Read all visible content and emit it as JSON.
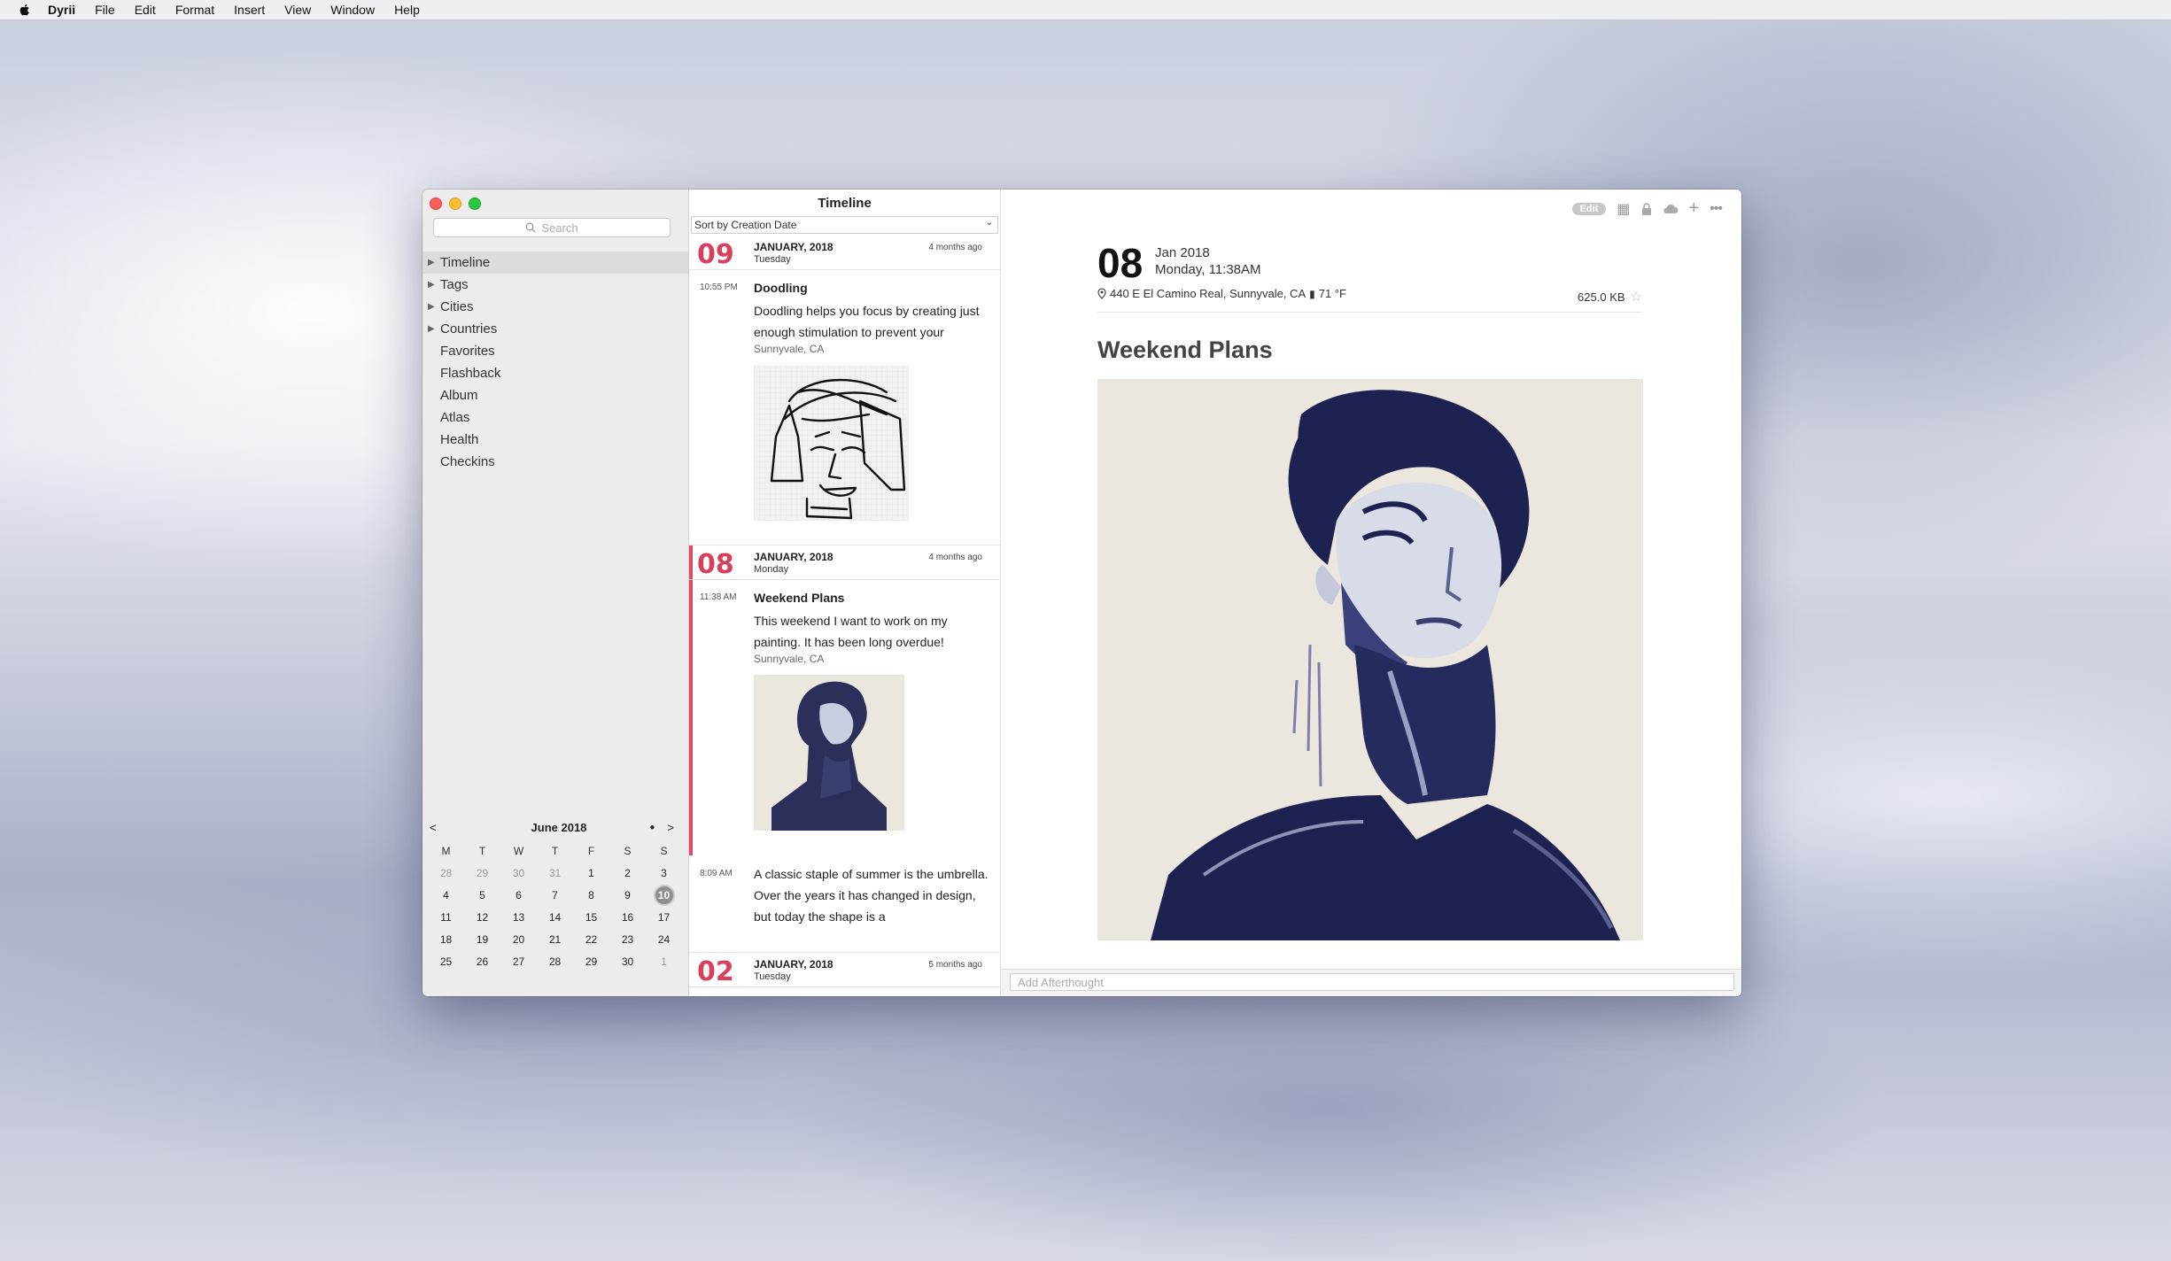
{
  "menubar": {
    "apple_icon": "apple-logo-icon",
    "items": [
      "Dyrii",
      "File",
      "Edit",
      "Format",
      "Insert",
      "View",
      "Window",
      "Help"
    ]
  },
  "sidebar": {
    "search_placeholder": "Search",
    "nav": [
      {
        "label": "Timeline",
        "expandable": true,
        "selected": true
      },
      {
        "label": "Tags",
        "expandable": true
      },
      {
        "label": "Cities",
        "expandable": true
      },
      {
        "label": "Countries",
        "expandable": true
      },
      {
        "label": "Favorites"
      },
      {
        "label": "Flashback"
      },
      {
        "label": "Album"
      },
      {
        "label": "Atlas"
      },
      {
        "label": "Health"
      },
      {
        "label": "Checkins"
      }
    ],
    "calendar": {
      "prev": "<",
      "next": ">",
      "dot": "●",
      "month": "June 2018",
      "weekdays": [
        "M",
        "T",
        "W",
        "T",
        "F",
        "S",
        "S"
      ],
      "weeks": [
        [
          "28",
          "29",
          "30",
          "31",
          "1",
          "2",
          "3"
        ],
        [
          "4",
          "5",
          "6",
          "7",
          "8",
          "9",
          "10"
        ],
        [
          "11",
          "12",
          "13",
          "14",
          "15",
          "16",
          "17"
        ],
        [
          "18",
          "19",
          "20",
          "21",
          "22",
          "23",
          "24"
        ],
        [
          "25",
          "26",
          "27",
          "28",
          "29",
          "30",
          "1"
        ]
      ],
      "today": "10"
    }
  },
  "timeline": {
    "title": "Timeline",
    "sort": "Sort by Creation Date",
    "days": [
      {
        "num": "09",
        "month": "JANUARY, 2018",
        "dow": "Tuesday",
        "ago": "4 months ago"
      },
      {
        "num": "08",
        "month": "JANUARY, 2018",
        "dow": "Monday",
        "ago": "4 months ago"
      },
      {
        "num": "02",
        "month": "JANUARY, 2018",
        "dow": "Tuesday",
        "ago": "5 months ago"
      }
    ],
    "entries": [
      {
        "time": "10:55 PM",
        "title": "Doodling",
        "body": "Doodling helps you focus by creating just enough stimulation to prevent your",
        "location": "Sunnyvale, CA"
      },
      {
        "time": "11:38 AM",
        "title": "Weekend Plans",
        "body": "This weekend I want to work on my painting. It has been long overdue!",
        "location": "Sunnyvale, CA"
      },
      {
        "time": "8:09 AM",
        "title": "",
        "body": "A classic staple of summer is the umbrella. Over the years it has changed in design, but today the shape is a"
      }
    ]
  },
  "detail": {
    "toolbar": {
      "edit": "Edit"
    },
    "day": "08",
    "month_year": "Jan 2018",
    "datetime": "Monday, 11:38AM",
    "address": "440 E El Camino Real, Sunnyvale, CA",
    "weather": "71 °F",
    "size": "625.0 KB",
    "title": "Weekend Plans",
    "afterthought_placeholder": "Add Afterthought"
  },
  "colors": {
    "accent": "#d8405a"
  }
}
